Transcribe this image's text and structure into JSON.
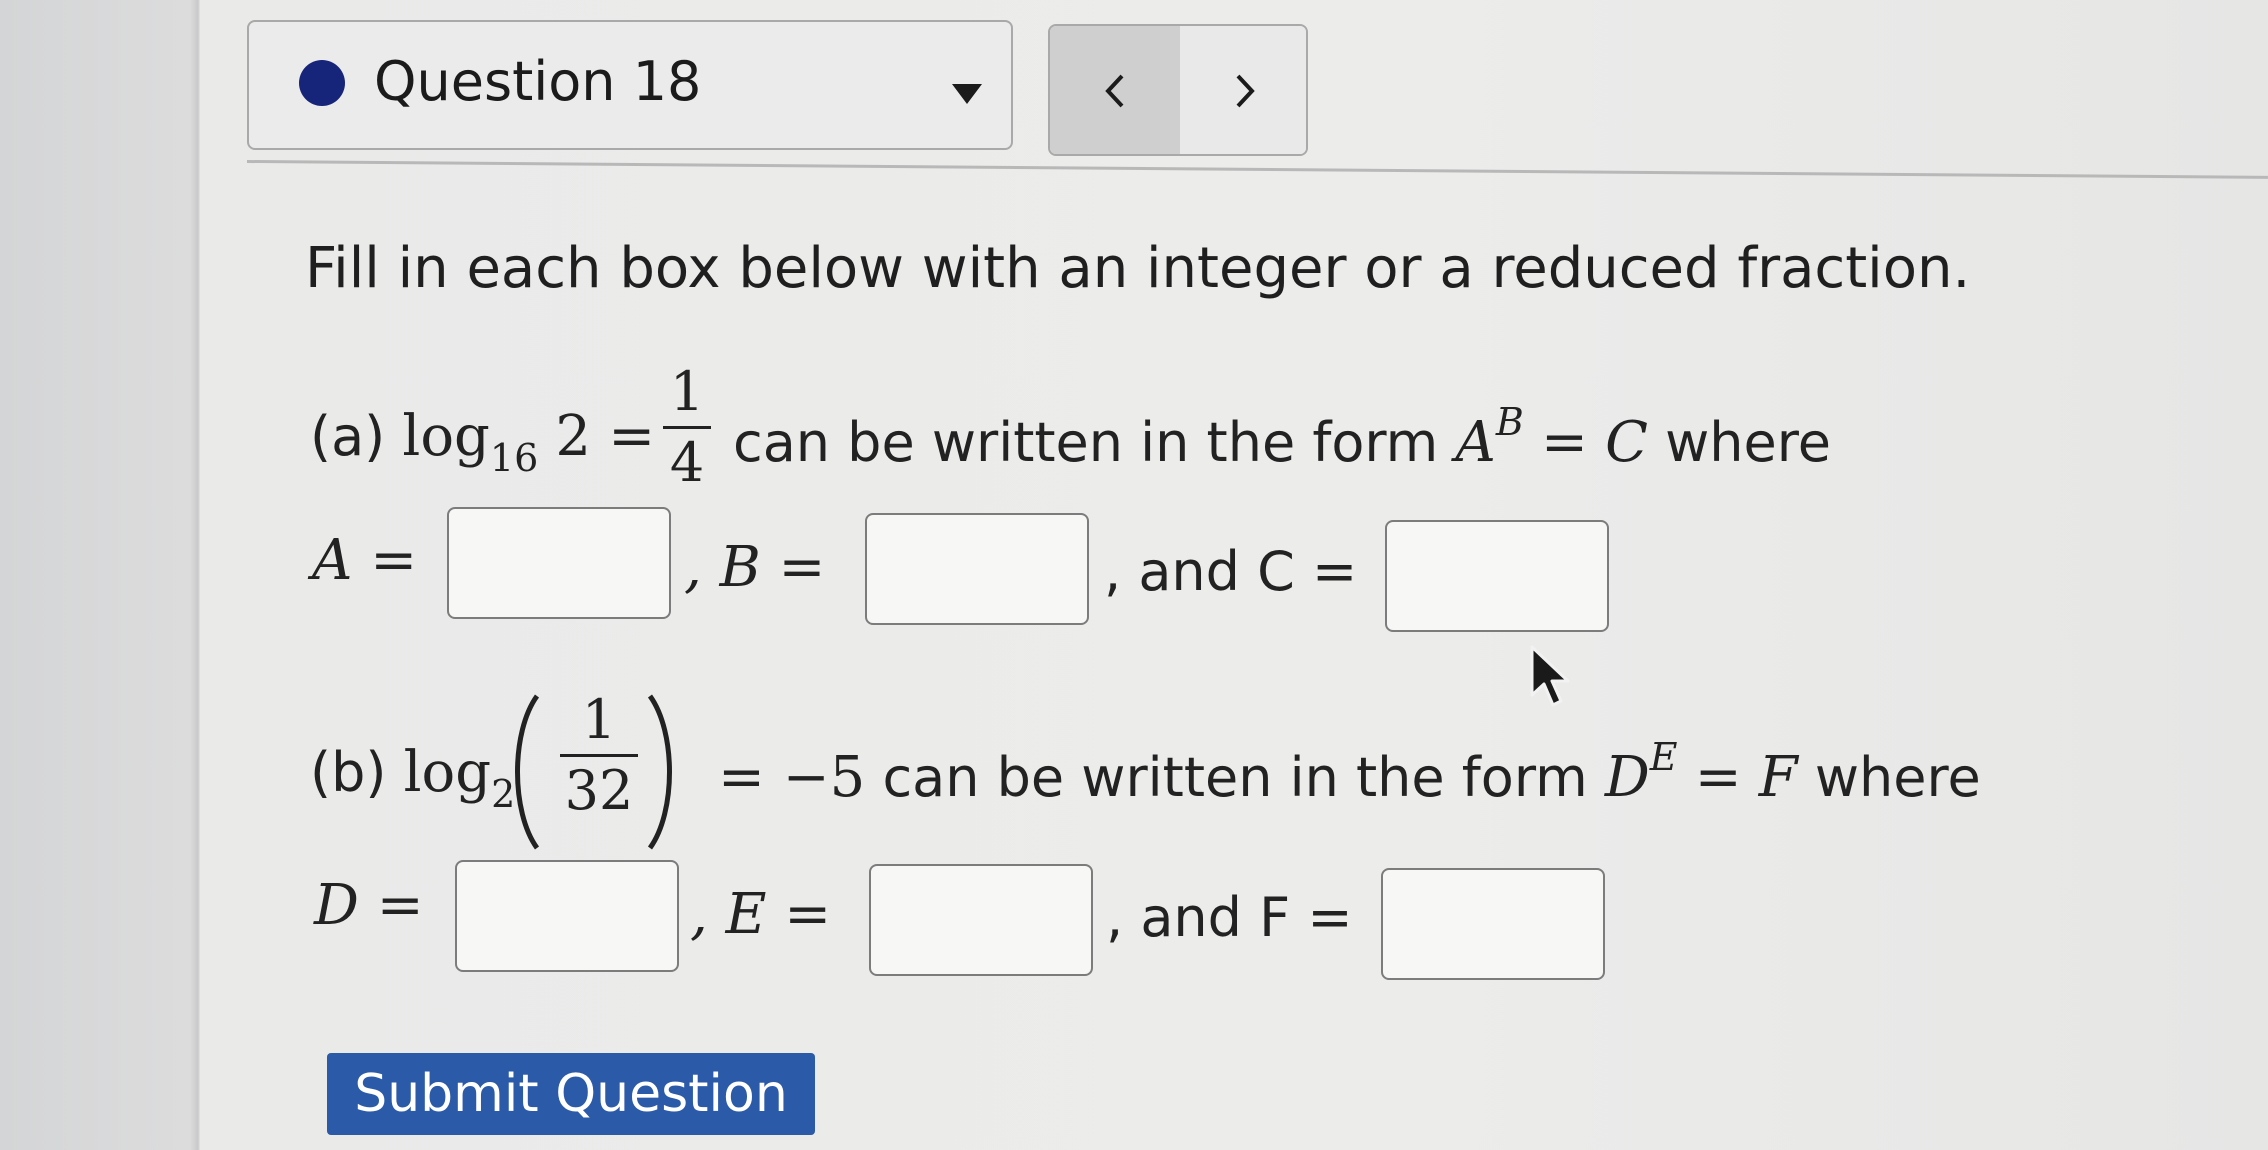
{
  "header": {
    "question_title": "Question 18",
    "status_color": "#16257a",
    "dropdown_icon": "caret-down-icon",
    "prev_icon": "chevron-left-icon",
    "next_icon": "chevron-right-icon"
  },
  "instructions": "Fill in each box below with an integer or a reduced fraction.",
  "part_a": {
    "label": "(a)",
    "log_word": "log",
    "log_base": "16",
    "log_arg": "2",
    "equals": "=",
    "frac_num": "1",
    "frac_den": "4",
    "phrase": "can be written in the form",
    "var_base": "A",
    "var_exp": "B",
    "var_result": "C",
    "where": "where",
    "ans_labels": [
      "A =",
      ", B =",
      ", and C ="
    ],
    "answers": [
      "",
      "",
      ""
    ]
  },
  "part_b": {
    "label": "(b)",
    "log_word": "log",
    "log_base": "2",
    "frac_num": "1",
    "frac_den": "32",
    "rhs": "= −5",
    "phrase": "can be written in the form",
    "var_base": "D",
    "var_exp": "E",
    "var_result": "F",
    "where": "where",
    "ans_labels": [
      "D =",
      ", E =",
      ", and F ="
    ],
    "answers": [
      "",
      "",
      ""
    ]
  },
  "submit_label": "Submit Question",
  "accent_color": "#2a5aa8"
}
